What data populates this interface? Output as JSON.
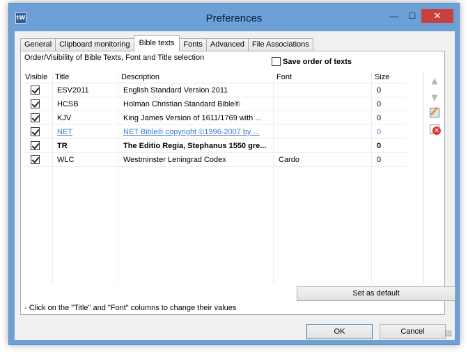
{
  "window": {
    "title": "Preferences",
    "app_icon_text": "tW",
    "minimize": "—",
    "maximize": "☐",
    "close": "✕"
  },
  "tabs": [
    {
      "label": "General"
    },
    {
      "label": "Clipboard monitoring"
    },
    {
      "label": "Bible texts",
      "active": true
    },
    {
      "label": "Fonts"
    },
    {
      "label": "Advanced"
    },
    {
      "label": "File Associations"
    }
  ],
  "panel": {
    "description": "Order/Visibility of Bible Texts, Font and Title selection",
    "save_order_label": "Save order of texts",
    "save_order_checked": false
  },
  "grid": {
    "headers": {
      "visible": "Visible",
      "title": "Title",
      "description": "Description",
      "font": "Font",
      "size": "Size"
    },
    "rows": [
      {
        "visible": true,
        "title": "ESV2011",
        "description": "English Standard Version 2011",
        "font": "",
        "size": "0"
      },
      {
        "visible": true,
        "title": "HCSB",
        "description": "Holman Christian Standard Bible®",
        "font": "",
        "size": "0"
      },
      {
        "visible": true,
        "title": "KJV",
        "description": "King James Version of 1611/1769 with ...",
        "font": "",
        "size": "0"
      },
      {
        "visible": true,
        "title": "NET",
        "description": "NET Bible® copyright ©1996-2007 by ...",
        "font": "",
        "size": "0",
        "style": "link"
      },
      {
        "visible": true,
        "title": "TR",
        "description": "The Editio Regia, Stephanus 1550 gre...",
        "font": "",
        "size": "0",
        "style": "bold"
      },
      {
        "visible": true,
        "title": "WLC",
        "description": "Westminster Leningrad Codex",
        "font": "Cardo",
        "size": "0"
      }
    ]
  },
  "side_buttons": {
    "up_icon": "▲",
    "down_icon": "▼"
  },
  "buttons": {
    "set_default": "Set as default",
    "ok": "OK",
    "cancel": "Cancel"
  },
  "hint": "- Click on the \"Title\" and \"Font\" columns to change their values",
  "colors": {
    "titlebar": "#6ca0d6",
    "close_button": "#c7423c",
    "link": "#3d7cd1"
  }
}
